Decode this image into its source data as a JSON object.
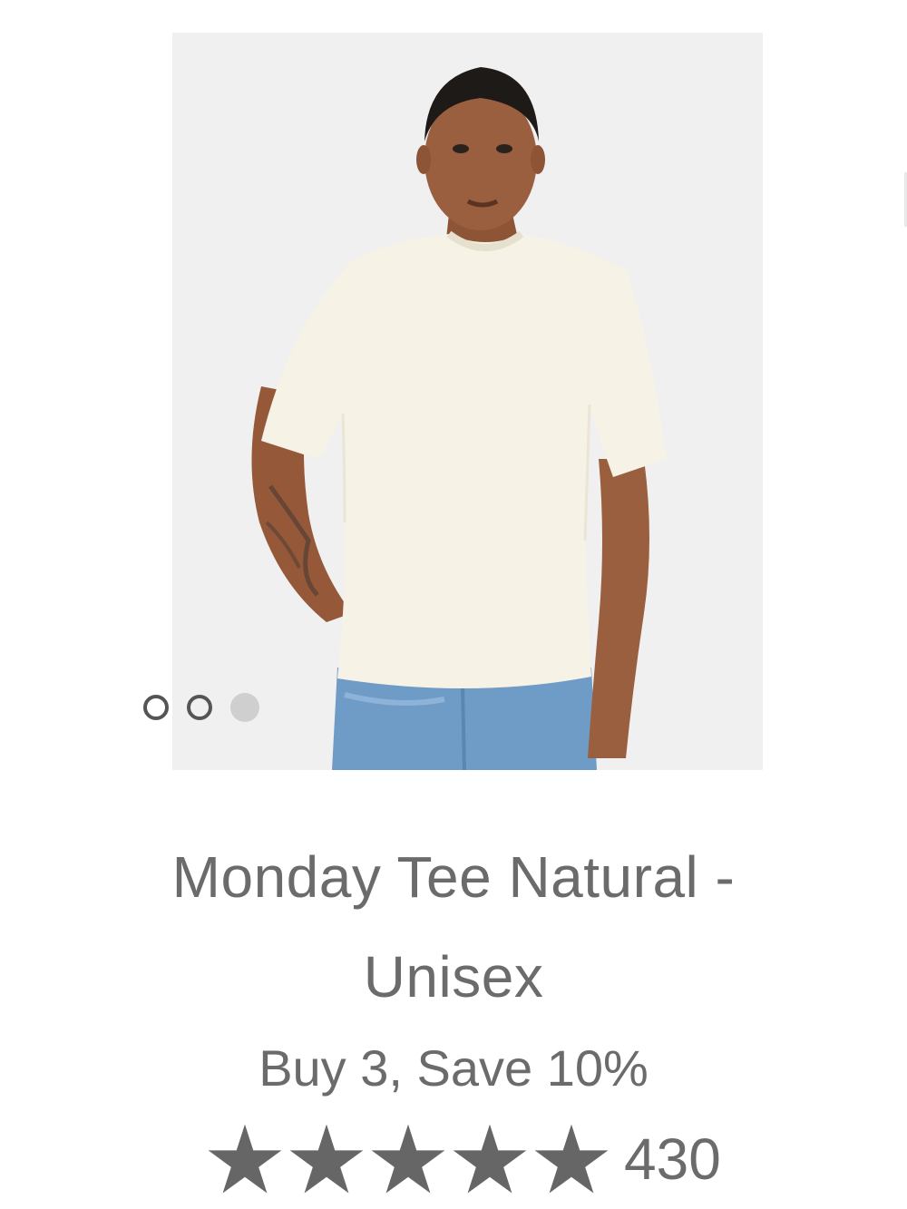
{
  "product": {
    "title_line1": "Monday Tee Natural -",
    "title_line2": "Unisex",
    "promo": "Buy 3, Save 10%",
    "rating": {
      "stars": 5,
      "max_stars": 5,
      "review_count": "430"
    },
    "image": {
      "alt": "Model wearing natural t-shirt and blue jeans",
      "active_slide": 3,
      "slide_count": 3
    }
  },
  "colors": {
    "text": "#6b6b6b",
    "star": "#666666",
    "dot_active": "#cfcfcf",
    "dot_inactive_border": "#555555",
    "tee": "#f6f2e6",
    "jeans": "#6f9cc7",
    "skin": "#9a5f3e"
  },
  "icons": {
    "star": "star-icon",
    "dot": "carousel-dot"
  }
}
